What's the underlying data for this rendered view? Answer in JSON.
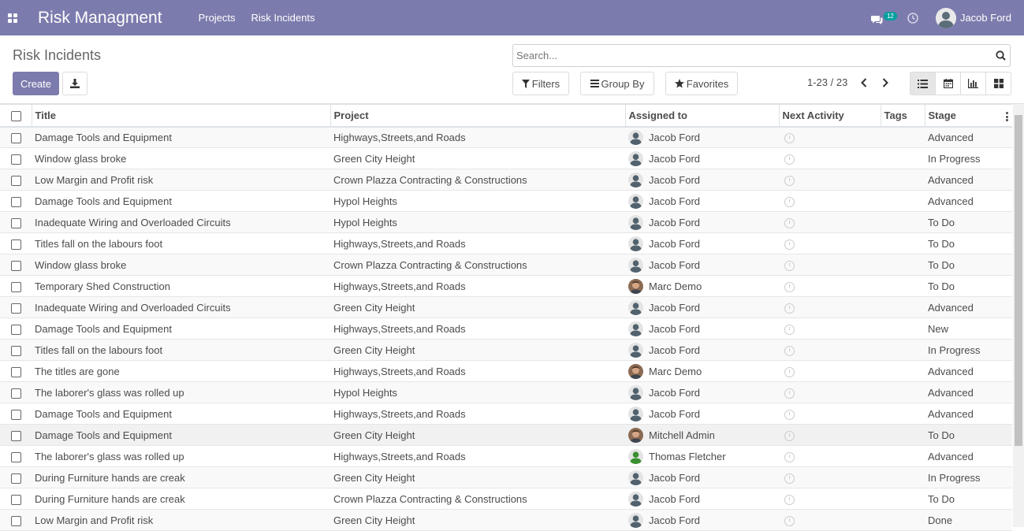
{
  "navbar": {
    "app_title": "Risk Managment",
    "menu": [
      "Projects",
      "Risk Incidents"
    ],
    "chat_badge": "12",
    "user_name": "Jacob Ford",
    "bg_color": "#7c7bad"
  },
  "control_panel": {
    "breadcrumb": "Risk Incidents",
    "create_label": "Create",
    "search_placeholder": "Search...",
    "filters_label": "Filters",
    "groupby_label": "Group By",
    "favorites_label": "Favorites",
    "pager": "1-23 / 23",
    "views": [
      "list-view-icon",
      "calendar-icon",
      "bar-chart-icon",
      "kanban-icon"
    ]
  },
  "table": {
    "columns": [
      "Title",
      "Project",
      "Assigned to",
      "Next Activity",
      "Tags",
      "Stage"
    ],
    "rows": [
      {
        "title": "Damage Tools and Equipment",
        "project": "Highways,Streets,and Roads",
        "assigned": "Jacob Ford",
        "stage": "Advanced"
      },
      {
        "title": "Window glass broke",
        "project": "Green City Height",
        "assigned": "Jacob Ford",
        "stage": "In Progress"
      },
      {
        "title": "Low Margin and Profit risk",
        "project": "Crown Plazza Contracting & Constructions",
        "assigned": "Jacob Ford",
        "stage": "Advanced"
      },
      {
        "title": "Damage Tools and Equipment",
        "project": "Hypol Heights",
        "assigned": "Jacob Ford",
        "stage": "Advanced"
      },
      {
        "title": "Inadequate Wiring and Overloaded Circuits",
        "project": "Hypol Heights",
        "assigned": "Jacob Ford",
        "stage": "To Do"
      },
      {
        "title": "Titles fall on the labours foot",
        "project": "Highways,Streets,and Roads",
        "assigned": "Jacob Ford",
        "stage": "To Do"
      },
      {
        "title": "Window glass broke",
        "project": "Crown Plazza Contracting & Constructions",
        "assigned": "Jacob Ford",
        "stage": "To Do"
      },
      {
        "title": "Temporary Shed Construction",
        "project": "Highways,Streets,and Roads",
        "assigned": "Marc Demo",
        "stage": "To Do"
      },
      {
        "title": "Inadequate Wiring and Overloaded Circuits",
        "project": "Green City Height",
        "assigned": "Jacob Ford",
        "stage": "Advanced"
      },
      {
        "title": "Damage Tools and Equipment",
        "project": "Highways,Streets,and Roads",
        "assigned": "Jacob Ford",
        "stage": "New"
      },
      {
        "title": "Titles fall on the labours foot",
        "project": "Green City Height",
        "assigned": "Jacob Ford",
        "stage": "In Progress"
      },
      {
        "title": "The titles are gone",
        "project": "Highways,Streets,and Roads",
        "assigned": "Marc Demo",
        "stage": "Advanced"
      },
      {
        "title": "The laborer's glass was rolled up",
        "project": "Hypol Heights",
        "assigned": "Jacob Ford",
        "stage": "Advanced"
      },
      {
        "title": "Damage Tools and Equipment",
        "project": "Highways,Streets,and Roads",
        "assigned": "Jacob Ford",
        "stage": "Advanced"
      },
      {
        "title": "Damage Tools and Equipment",
        "project": "Green City Height",
        "assigned": "Mitchell Admin",
        "stage": "To Do"
      },
      {
        "title": "The laborer's glass was rolled up",
        "project": "Highways,Streets,and Roads",
        "assigned": "Thomas Fletcher",
        "stage": "Advanced"
      },
      {
        "title": "During Furniture hands are creak",
        "project": "Green City Height",
        "assigned": "Jacob Ford",
        "stage": "In Progress"
      },
      {
        "title": "During Furniture hands are creak",
        "project": "Crown Plazza Contracting & Constructions",
        "assigned": "Jacob Ford",
        "stage": "To Do"
      },
      {
        "title": "Low Margin and Profit risk",
        "project": "Green City Height",
        "assigned": "Jacob Ford",
        "stage": "Done"
      }
    ]
  }
}
